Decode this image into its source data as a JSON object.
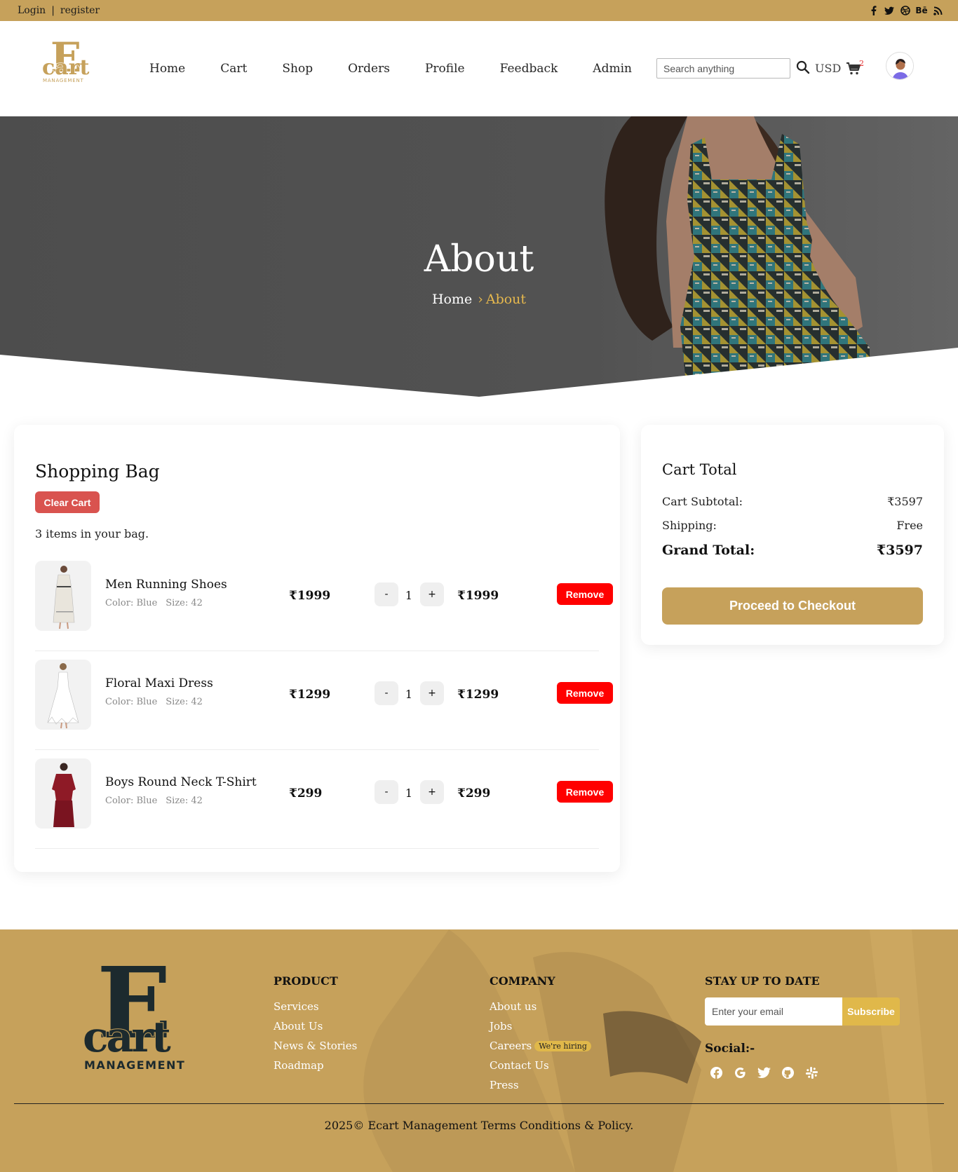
{
  "topbar": {
    "login": "Login",
    "separator": "|",
    "register": "register",
    "social_icons": [
      "facebook-icon",
      "twitter-icon",
      "dribbble-icon",
      "behance-icon",
      "rss-icon"
    ],
    "behance_text": "Bē"
  },
  "brand": {
    "logo_letter": "E",
    "logo_word": "cart",
    "logo_sub": "MANAGEMENT",
    "accent_color": "#c6a15b",
    "gold_highlight": "#e6b84d"
  },
  "nav": {
    "items": [
      "Home",
      "Cart",
      "Shop",
      "Orders",
      "Profile",
      "Feedback",
      "Admin"
    ]
  },
  "search": {
    "placeholder": "Search anything"
  },
  "currency": "USD",
  "cart_badge": "2",
  "hero": {
    "title": "About",
    "breadcrumb_home": "Home",
    "breadcrumb_sep": "›",
    "breadcrumb_current": "About"
  },
  "bag": {
    "title": "Shopping Bag",
    "clear_label": "Clear Cart",
    "count_text": "3 items in your bag.",
    "items": [
      {
        "name": "Men Running Shoes",
        "color": "Color: Blue",
        "size": "Size: 42",
        "price": "₹1999",
        "qty": "1",
        "total": "₹1999",
        "minus": "-",
        "plus": "+",
        "remove": "Remove"
      },
      {
        "name": "Floral Maxi Dress",
        "color": "Color: Blue",
        "size": "Size: 42",
        "price": "₹1299",
        "qty": "1",
        "total": "₹1299",
        "minus": "-",
        "plus": "+",
        "remove": "Remove"
      },
      {
        "name": "Boys Round Neck T-Shirt",
        "color": "Color: Blue",
        "size": "Size: 42",
        "price": "₹299",
        "qty": "1",
        "total": "₹299",
        "minus": "-",
        "plus": "+",
        "remove": "Remove"
      }
    ]
  },
  "totals": {
    "title": "Cart Total",
    "subtotal_label": "Cart Subtotal:",
    "subtotal_value": "₹3597",
    "shipping_label": "Shipping:",
    "shipping_value": "Free",
    "grand_label": "Grand Total:",
    "grand_value": "₹3597",
    "checkout_label": "Proceed to Checkout"
  },
  "footer": {
    "product": {
      "heading": "PRODUCT",
      "links": [
        "Services",
        "About Us",
        "News & Stories",
        "Roadmap"
      ]
    },
    "company": {
      "heading": "COMPANY",
      "links": [
        "About us",
        "Jobs",
        "Careers",
        "Contact Us",
        "Press"
      ],
      "hiring_badge": "We're hiring"
    },
    "newsletter": {
      "heading": "STAY UP TO DATE",
      "email_placeholder": "Enter your email",
      "subscribe_label": "Subscribe",
      "social_label": "Social:-",
      "social_icons": [
        "facebook-icon",
        "google-icon",
        "twitter-icon",
        "github-icon",
        "slack-icon"
      ]
    },
    "copyright": "2025© Ecart Management Terms Conditions & Policy."
  }
}
